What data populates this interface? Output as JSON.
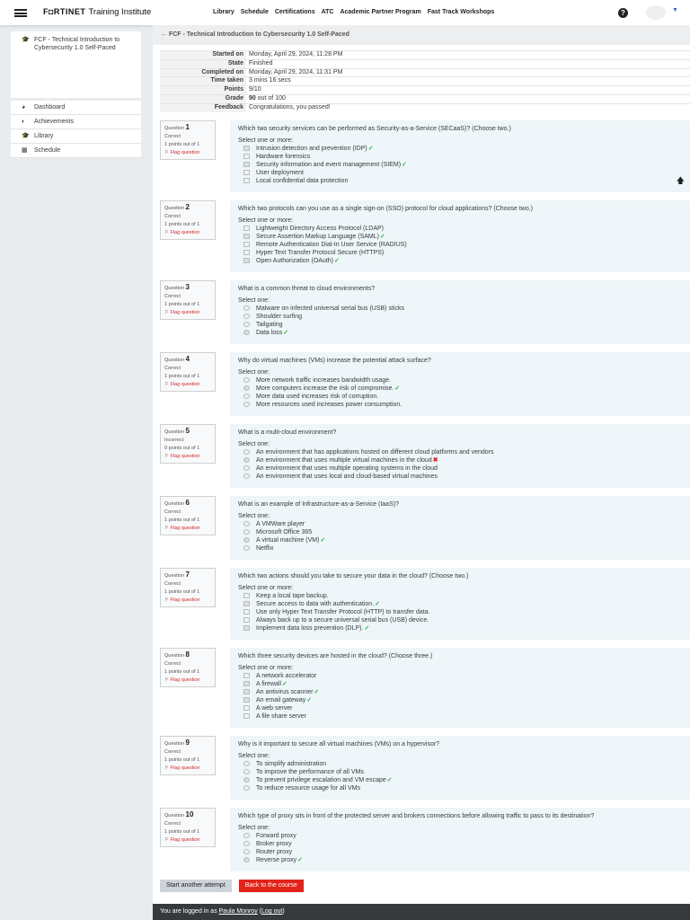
{
  "header": {
    "brand": "F◘RTINET",
    "brand_suffix": "Training Institute",
    "nav": [
      "Library",
      "Schedule",
      "Certifications",
      "ATC",
      "Academic Partner Program",
      "Fast Track Workshops"
    ],
    "help": "?"
  },
  "sidebar": {
    "course": "FCF - Technical Introduction to Cybersecurity 1.0 Self-Paced",
    "items": [
      {
        "label": "Dashboard",
        "icon": "dashboard-icon"
      },
      {
        "label": "Achievements",
        "icon": "shield-icon"
      },
      {
        "label": "Library",
        "icon": "graduation-cap-icon"
      },
      {
        "label": "Schedule",
        "icon": "calendar-icon"
      }
    ]
  },
  "breadcrumb": "FCF - Technical Introduction to Cybersecurity 1.0 Self-Paced",
  "summary": [
    {
      "k": "Started on",
      "v": "Monday, April 29, 2024, 11:28 PM"
    },
    {
      "k": "State",
      "v": "Finished"
    },
    {
      "k": "Completed on",
      "v": "Monday, April 29, 2024, 11:31 PM"
    },
    {
      "k": "Time taken",
      "v": "3 mins 16 secs"
    },
    {
      "k": "Points",
      "v": "9/10"
    },
    {
      "k": "Grade",
      "v": "90",
      "v2": " out of 100"
    },
    {
      "k": "Feedback",
      "v": "Congratulations, you passed!"
    }
  ],
  "labels": {
    "question": "Question",
    "flag": "Flag question"
  },
  "questions": [
    {
      "n": "1",
      "status": "Correct",
      "points": "1 points out of 1",
      "text": "Which two security services can be performed as Security-as-a-Service (SECaaS)? (Choose two.)",
      "prompt": "Select one or more:",
      "type": "checkbox",
      "options": [
        {
          "t": "Intrusion detection and prevention (IDP)",
          "sel": true,
          "mark": "correct"
        },
        {
          "t": "Hardware forensics"
        },
        {
          "t": "Security information and event management (SIEM)",
          "sel": true,
          "mark": "correct"
        },
        {
          "t": "User deployment"
        },
        {
          "t": "Local confidential data protection"
        }
      ]
    },
    {
      "n": "2",
      "status": "Correct",
      "points": "1 points out of 1",
      "text": "Which two protocols can you use as a single sign-on (SSO) protocol for cloud applications? (Choose two.)",
      "prompt": "Select one or more:",
      "type": "checkbox",
      "options": [
        {
          "t": "Lightweight Directory Access Protocol (LDAP)"
        },
        {
          "t": "Secure Assertion Markup Language (SAML)",
          "sel": true,
          "mark": "correct"
        },
        {
          "t": "Remote Authentication Dial-In User Service (RADIUS)"
        },
        {
          "t": "Hyper Text Transfer Protocol Secure (HTTPS)"
        },
        {
          "t": "Open Authorization (OAuth)",
          "sel": true,
          "mark": "correct"
        }
      ]
    },
    {
      "n": "3",
      "status": "Correct",
      "points": "1 points out of 1",
      "text": "What is a common threat to cloud environments?",
      "prompt": "Select one:",
      "type": "radio",
      "options": [
        {
          "t": "Malware on infected universal serial bus (USB) sticks"
        },
        {
          "t": "Shoulder surfing"
        },
        {
          "t": "Tailgating"
        },
        {
          "t": "Data loss",
          "sel": true,
          "mark": "correct"
        }
      ]
    },
    {
      "n": "4",
      "status": "Correct",
      "points": "1 points out of 1",
      "text": "Why do virtual machines (VMs) increase the potential attack surface?",
      "prompt": "Select one:",
      "type": "radio",
      "options": [
        {
          "t": "More network traffic increases bandwidth usage."
        },
        {
          "t": "More computers increase the risk of compromise.",
          "sel": true,
          "mark": "correct"
        },
        {
          "t": "More data used increases risk of corruption."
        },
        {
          "t": "More resources used increases power consumption."
        }
      ]
    },
    {
      "n": "5",
      "status": "Incorrect",
      "points": "0 points out of 1",
      "text": "What is a multi-cloud environment?",
      "prompt": "Select one:",
      "type": "radio",
      "options": [
        {
          "t": "An environment that has applications hosted on different cloud platforms and vendors"
        },
        {
          "t": "An environment that uses multiple virtual machines in the cloud",
          "sel": true,
          "mark": "incorrect"
        },
        {
          "t": "An environment that uses multiple operating systems in the cloud"
        },
        {
          "t": "An environment that uses local and cloud-based virtual machines"
        }
      ]
    },
    {
      "n": "6",
      "status": "Correct",
      "points": "1 points out of 1",
      "text": "What is an example of Infrastructure-as-a-Service (IaaS)?",
      "prompt": "Select one:",
      "type": "radio",
      "options": [
        {
          "t": "A VMWare player"
        },
        {
          "t": "Microsoft Office 365"
        },
        {
          "t": "A virtual machine (VM)",
          "sel": true,
          "mark": "correct"
        },
        {
          "t": "Netflix"
        }
      ]
    },
    {
      "n": "7",
      "status": "Correct",
      "points": "1 points out of 1",
      "text": "Which two actions should you take to secure your data in the cloud? (Choose two.)",
      "prompt": "Select one or more:",
      "type": "checkbox",
      "options": [
        {
          "t": "Keep a local tape backup."
        },
        {
          "t": "Secure access to data with authentication.",
          "sel": true,
          "mark": "correct"
        },
        {
          "t": "Use only Hyper Text Transfer Protocol (HTTP) to transfer data."
        },
        {
          "t": "Always back up to a secure universal serial bus (USB) device."
        },
        {
          "t": "Implement data loss prevention (DLP).",
          "sel": true,
          "mark": "correct"
        }
      ]
    },
    {
      "n": "8",
      "status": "Correct",
      "points": "1 points out of 1",
      "text": "Which three security devices are hosted in the cloud? (Choose three.)",
      "prompt": "Select one or more:",
      "type": "checkbox",
      "options": [
        {
          "t": "A network accelerator"
        },
        {
          "t": "A firewall",
          "sel": true,
          "mark": "correct"
        },
        {
          "t": "An antivirus scanner",
          "sel": true,
          "mark": "correct"
        },
        {
          "t": "An email gateway",
          "sel": true,
          "mark": "correct"
        },
        {
          "t": "A web server"
        },
        {
          "t": "A file share server"
        }
      ]
    },
    {
      "n": "9",
      "status": "Correct",
      "points": "1 points out of 1",
      "text": "Why is it important to secure all virtual machines (VMs) on a hypervisor?",
      "prompt": "Select one:",
      "type": "radio",
      "options": [
        {
          "t": "To simplify administration"
        },
        {
          "t": "To improve the performance of all VMs"
        },
        {
          "t": "To prevent privilege escalation and VM escape",
          "sel": true,
          "mark": "correct"
        },
        {
          "t": "To reduce resource usage for all VMs"
        }
      ]
    },
    {
      "n": "10",
      "status": "Correct",
      "points": "1 points out of 1",
      "text": "Which type of proxy sits in front of the protected server and brokers connections before allowing traffic to pass to its destination?",
      "prompt": "Select one:",
      "type": "radio",
      "options": [
        {
          "t": "Forward proxy"
        },
        {
          "t": "Broker proxy"
        },
        {
          "t": "Router proxy"
        },
        {
          "t": "Reverse proxy",
          "sel": true,
          "mark": "correct"
        }
      ]
    }
  ],
  "buttons": {
    "retry": "Start another attempt",
    "back": "Back to the course"
  },
  "footer": {
    "prefix": "You are logged in as ",
    "user": "Paula Monroy",
    "logout": "Log out"
  },
  "colors": {
    "accent": "#e2231a",
    "correct": "#3cb043",
    "question_bg": "#eef6f9"
  }
}
